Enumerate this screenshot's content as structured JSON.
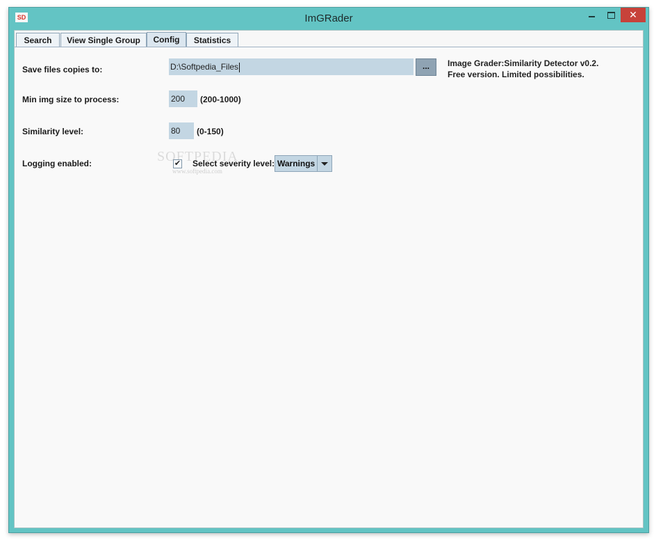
{
  "window": {
    "title": "ImGRader",
    "app_icon_text": "SD",
    "controls": {
      "minimize": "minimize-icon",
      "maximize": "maximize-icon",
      "close": "✕"
    }
  },
  "tabs": [
    {
      "label": "Search"
    },
    {
      "label": "View Single Group"
    },
    {
      "label": "Config"
    },
    {
      "label": "Statistics"
    }
  ],
  "active_tab": "Config",
  "config": {
    "save_label": "Save files copies to:",
    "save_path": "D:\\Softpedia_Files",
    "browse_label": "...",
    "info_line1": "Image Grader:Similarity Detector v0.2.",
    "info_line2": "Free version. Limited possibilities.",
    "min_size_label": "Min img size to process:",
    "min_size_value": "200",
    "min_size_range": "(200-1000)",
    "similarity_label": "Similarity level:",
    "similarity_value": "80",
    "similarity_range": "(0-150)",
    "logging_label": "Logging enabled:",
    "logging_checked": true,
    "severity_label": "Select severity level:",
    "severity_value": "Warnings"
  },
  "watermark": {
    "line1": "SOFTPEDIA",
    "line2": "www.softpedia.com"
  },
  "colors": {
    "titlebar": "#63c4c4",
    "close": "#c7423a",
    "field": "#c3d6e3"
  }
}
